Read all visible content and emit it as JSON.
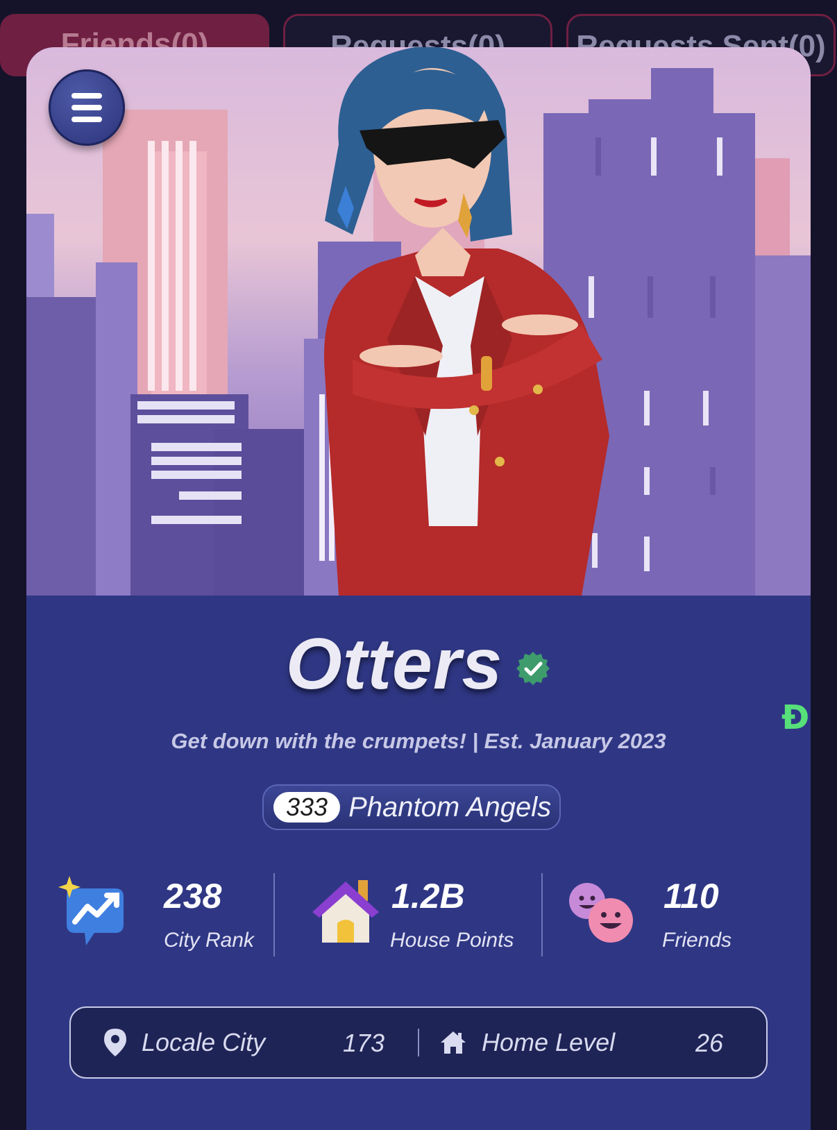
{
  "tabs": [
    {
      "label": "Friends(0)"
    },
    {
      "label": "Requests(0)"
    },
    {
      "label": "Requests Sent(0)"
    }
  ],
  "profile": {
    "name": "Otters",
    "motto": "Get down with the crumpets! | Est. January 2023",
    "club_count": "333",
    "club_name": "Phantom Angels"
  },
  "stats": {
    "city_rank": {
      "value": "238",
      "label": "City Rank"
    },
    "house_points": {
      "value": "1.2B",
      "label": "House Points"
    },
    "friends": {
      "value": "110",
      "label": "Friends"
    }
  },
  "details": {
    "locale_label": "Locale City",
    "locale_value": "173",
    "home_label": "Home Level",
    "home_value": "26"
  },
  "side_glyph": "Đ",
  "icons": [
    "menu-icon",
    "verified-icon",
    "city-rank-icon",
    "house-icon",
    "friends-icon",
    "location-pin-icon",
    "home-icon"
  ],
  "colors": {
    "card": "#2f3784",
    "accent": "#6f1f41",
    "verified": "#3e9c6c"
  }
}
